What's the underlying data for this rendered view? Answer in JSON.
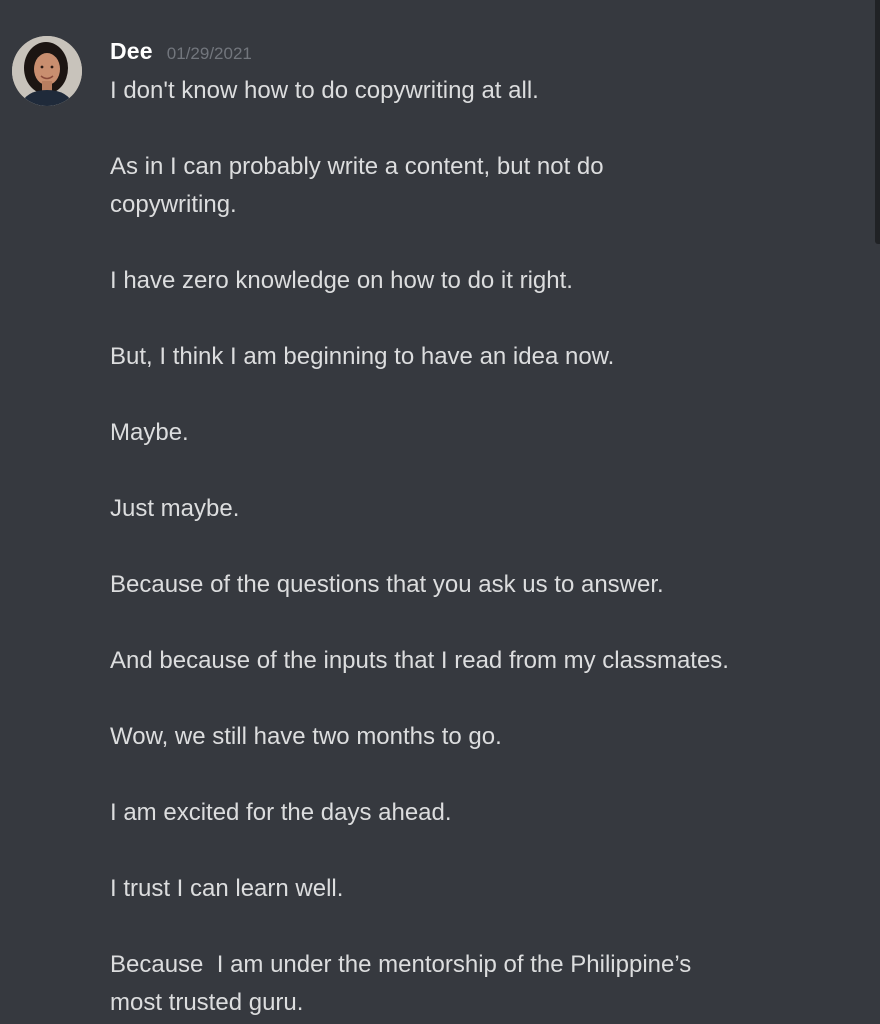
{
  "message": {
    "author": "Dee",
    "timestamp": "01/29/2021",
    "lines": [
      "I don't know how to do copywriting at all.",
      "As in I can probably write a content, but not do\ncopywriting.",
      "I have zero knowledge on how to do it right.",
      "But, I think I am beginning to have an idea now.",
      "Maybe.",
      "Just maybe.",
      "Because of the questions that you ask us to answer.",
      "And because of the inputs that I read from my classmates.",
      "Wow, we still have two months to go.",
      "I am excited for the days ahead.",
      "I trust I can learn well.",
      "Because  I am under the mentorship of the Philippine’s\nmost trusted guru."
    ]
  },
  "colors": {
    "background": "#36393f",
    "username": "#ffffff",
    "timestamp": "#72767d",
    "message_text": "#dcddde"
  }
}
